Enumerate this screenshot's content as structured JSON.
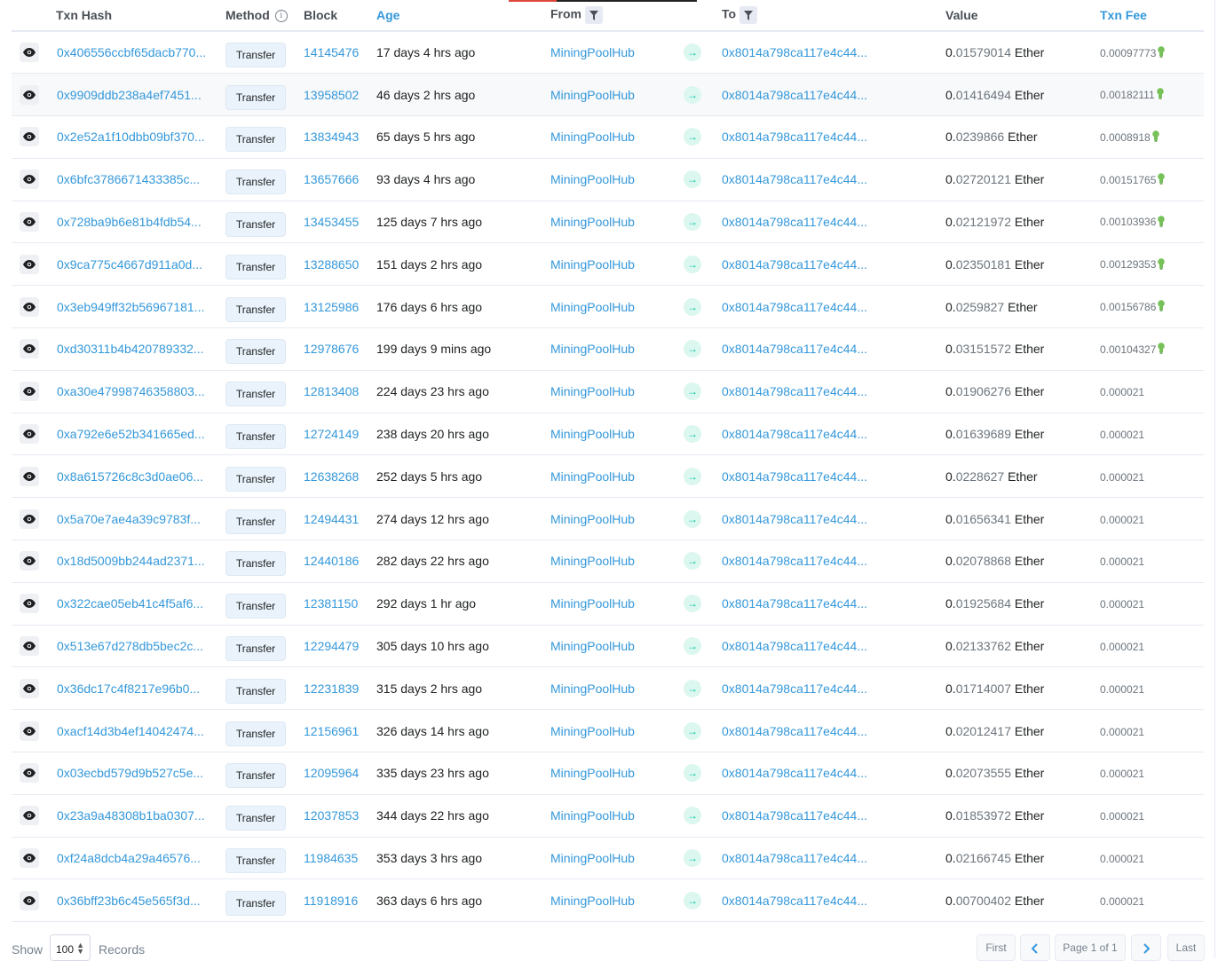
{
  "header": {
    "txn_hash": "Txn Hash",
    "method": "Method",
    "block": "Block",
    "age": "Age",
    "from": "From",
    "to": "To",
    "value": "Value",
    "txn_fee": "Txn Fee"
  },
  "colors": {
    "link": "#3498db",
    "arrow": "#00c9a7",
    "bulb": "#77c159"
  },
  "icons": [
    "eye-icon",
    "info-icon",
    "filter-icon",
    "arrow-right-icon",
    "lightbulb-icon",
    "chevron-left-icon",
    "chevron-right-icon"
  ],
  "rows": [
    {
      "hash": "0x406556ccbf65dacb770...",
      "method": "Transfer",
      "block": "14145476",
      "age": "17 days 4 hrs ago",
      "from": "MiningPoolHub",
      "to": "0x8014a798ca117e4c44...",
      "value_int": "0.",
      "value_dec": "01579014",
      "unit": " Ether",
      "fee": "0.00097773",
      "bulb": true
    },
    {
      "hash": "0x9909ddb238a4ef7451...",
      "method": "Transfer",
      "block": "13958502",
      "age": "46 days 2 hrs ago",
      "from": "MiningPoolHub",
      "to": "0x8014a798ca117e4c44...",
      "value_int": "0.",
      "value_dec": "01416494",
      "unit": " Ether",
      "fee": "0.00182111",
      "bulb": true
    },
    {
      "hash": "0x2e52a1f10dbb09bf370...",
      "method": "Transfer",
      "block": "13834943",
      "age": "65 days 5 hrs ago",
      "from": "MiningPoolHub",
      "to": "0x8014a798ca117e4c44...",
      "value_int": "0.",
      "value_dec": "0239866",
      "unit": " Ether",
      "fee": "0.0008918",
      "bulb": true
    },
    {
      "hash": "0x6bfc3786671433385c...",
      "method": "Transfer",
      "block": "13657666",
      "age": "93 days 4 hrs ago",
      "from": "MiningPoolHub",
      "to": "0x8014a798ca117e4c44...",
      "value_int": "0.",
      "value_dec": "02720121",
      "unit": " Ether",
      "fee": "0.00151765",
      "bulb": true
    },
    {
      "hash": "0x728ba9b6e81b4fdb54...",
      "method": "Transfer",
      "block": "13453455",
      "age": "125 days 7 hrs ago",
      "from": "MiningPoolHub",
      "to": "0x8014a798ca117e4c44...",
      "value_int": "0.",
      "value_dec": "02121972",
      "unit": " Ether",
      "fee": "0.00103936",
      "bulb": true
    },
    {
      "hash": "0x9ca775c4667d911a0d...",
      "method": "Transfer",
      "block": "13288650",
      "age": "151 days 2 hrs ago",
      "from": "MiningPoolHub",
      "to": "0x8014a798ca117e4c44...",
      "value_int": "0.",
      "value_dec": "02350181",
      "unit": " Ether",
      "fee": "0.00129353",
      "bulb": true
    },
    {
      "hash": "0x3eb949ff32b56967181...",
      "method": "Transfer",
      "block": "13125986",
      "age": "176 days 6 hrs ago",
      "from": "MiningPoolHub",
      "to": "0x8014a798ca117e4c44...",
      "value_int": "0.",
      "value_dec": "0259827",
      "unit": " Ether",
      "fee": "0.00156786",
      "bulb": true
    },
    {
      "hash": "0xd30311b4b420789332...",
      "method": "Transfer",
      "block": "12978676",
      "age": "199 days 9 mins ago",
      "from": "MiningPoolHub",
      "to": "0x8014a798ca117e4c44...",
      "value_int": "0.",
      "value_dec": "03151572",
      "unit": " Ether",
      "fee": "0.00104327",
      "bulb": true
    },
    {
      "hash": "0xa30e47998746358803...",
      "method": "Transfer",
      "block": "12813408",
      "age": "224 days 23 hrs ago",
      "from": "MiningPoolHub",
      "to": "0x8014a798ca117e4c44...",
      "value_int": "0.",
      "value_dec": "01906276",
      "unit": " Ether",
      "fee": "0.000021",
      "bulb": false
    },
    {
      "hash": "0xa792e6e52b341665ed...",
      "method": "Transfer",
      "block": "12724149",
      "age": "238 days 20 hrs ago",
      "from": "MiningPoolHub",
      "to": "0x8014a798ca117e4c44...",
      "value_int": "0.",
      "value_dec": "01639689",
      "unit": " Ether",
      "fee": "0.000021",
      "bulb": false
    },
    {
      "hash": "0x8a615726c8c3d0ae06...",
      "method": "Transfer",
      "block": "12638268",
      "age": "252 days 5 hrs ago",
      "from": "MiningPoolHub",
      "to": "0x8014a798ca117e4c44...",
      "value_int": "0.",
      "value_dec": "0228627",
      "unit": " Ether",
      "fee": "0.000021",
      "bulb": false
    },
    {
      "hash": "0x5a70e7ae4a39c9783f...",
      "method": "Transfer",
      "block": "12494431",
      "age": "274 days 12 hrs ago",
      "from": "MiningPoolHub",
      "to": "0x8014a798ca117e4c44...",
      "value_int": "0.",
      "value_dec": "01656341",
      "unit": " Ether",
      "fee": "0.000021",
      "bulb": false
    },
    {
      "hash": "0x18d5009bb244ad2371...",
      "method": "Transfer",
      "block": "12440186",
      "age": "282 days 22 hrs ago",
      "from": "MiningPoolHub",
      "to": "0x8014a798ca117e4c44...",
      "value_int": "0.",
      "value_dec": "02078868",
      "unit": " Ether",
      "fee": "0.000021",
      "bulb": false
    },
    {
      "hash": "0x322cae05eb41c4f5af6...",
      "method": "Transfer",
      "block": "12381150",
      "age": "292 days 1 hr ago",
      "from": "MiningPoolHub",
      "to": "0x8014a798ca117e4c44...",
      "value_int": "0.",
      "value_dec": "01925684",
      "unit": " Ether",
      "fee": "0.000021",
      "bulb": false
    },
    {
      "hash": "0x513e67d278db5bec2c...",
      "method": "Transfer",
      "block": "12294479",
      "age": "305 days 10 hrs ago",
      "from": "MiningPoolHub",
      "to": "0x8014a798ca117e4c44...",
      "value_int": "0.",
      "value_dec": "02133762",
      "unit": " Ether",
      "fee": "0.000021",
      "bulb": false
    },
    {
      "hash": "0x36dc17c4f8217e96b0...",
      "method": "Transfer",
      "block": "12231839",
      "age": "315 days 2 hrs ago",
      "from": "MiningPoolHub",
      "to": "0x8014a798ca117e4c44...",
      "value_int": "0.",
      "value_dec": "01714007",
      "unit": " Ether",
      "fee": "0.000021",
      "bulb": false
    },
    {
      "hash": "0xacf14d3b4ef14042474...",
      "method": "Transfer",
      "block": "12156961",
      "age": "326 days 14 hrs ago",
      "from": "MiningPoolHub",
      "to": "0x8014a798ca117e4c44...",
      "value_int": "0.",
      "value_dec": "02012417",
      "unit": " Ether",
      "fee": "0.000021",
      "bulb": false
    },
    {
      "hash": "0x03ecbd579d9b527c5e...",
      "method": "Transfer",
      "block": "12095964",
      "age": "335 days 23 hrs ago",
      "from": "MiningPoolHub",
      "to": "0x8014a798ca117e4c44...",
      "value_int": "0.",
      "value_dec": "02073555",
      "unit": " Ether",
      "fee": "0.000021",
      "bulb": false
    },
    {
      "hash": "0x23a9a48308b1ba0307...",
      "method": "Transfer",
      "block": "12037853",
      "age": "344 days 22 hrs ago",
      "from": "MiningPoolHub",
      "to": "0x8014a798ca117e4c44...",
      "value_int": "0.",
      "value_dec": "01853972",
      "unit": " Ether",
      "fee": "0.000021",
      "bulb": false
    },
    {
      "hash": "0xf24a8dcb4a29a46576...",
      "method": "Transfer",
      "block": "11984635",
      "age": "353 days 3 hrs ago",
      "from": "MiningPoolHub",
      "to": "0x8014a798ca117e4c44...",
      "value_int": "0.",
      "value_dec": "02166745",
      "unit": " Ether",
      "fee": "0.000021",
      "bulb": false
    },
    {
      "hash": "0x36bff23b6c45e565f3d...",
      "method": "Transfer",
      "block": "11918916",
      "age": "363 days 6 hrs ago",
      "from": "MiningPoolHub",
      "to": "0x8014a798ca117e4c44...",
      "value_int": "0.",
      "value_dec": "00700402",
      "unit": " Ether",
      "fee": "0.000021",
      "bulb": false
    }
  ],
  "footer": {
    "show": "Show",
    "page_size": "100",
    "records": "Records",
    "first": "First",
    "page_info": "Page 1 of 1",
    "last": "Last"
  }
}
